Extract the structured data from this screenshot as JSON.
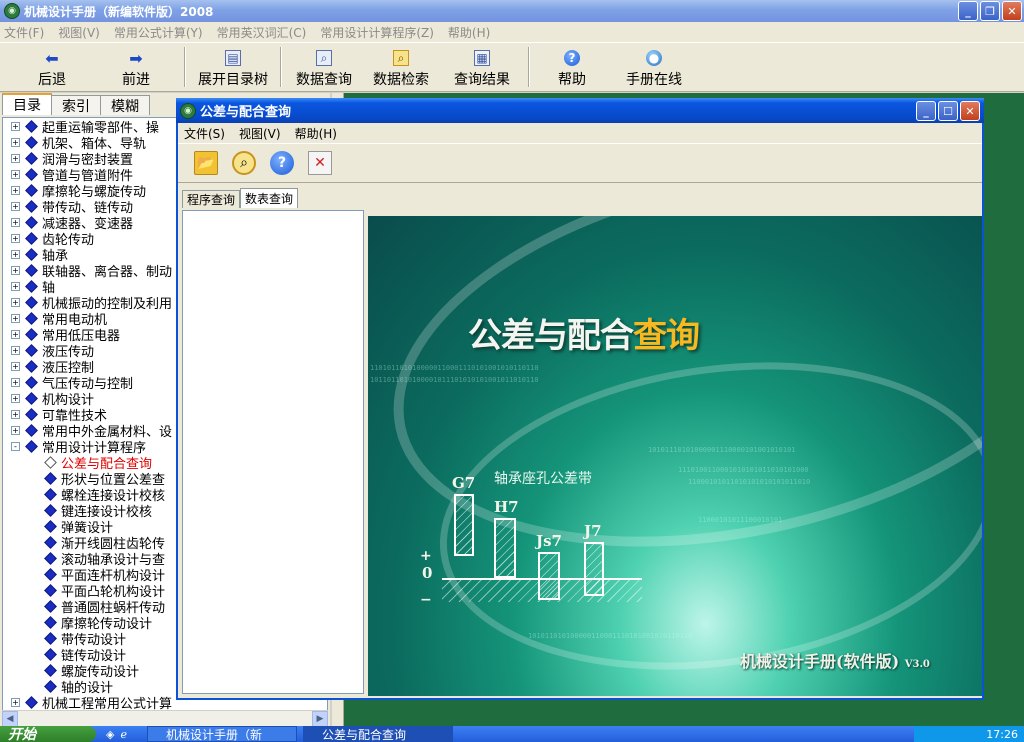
{
  "main_window": {
    "title": "机械设计手册（新编软件版）2008",
    "buttons": {
      "minimize": "_",
      "maximize": "❐",
      "close": "✕"
    }
  },
  "menu": [
    "文件(F)",
    "视图(V)",
    "常用公式计算(Y)",
    "常用英汉词汇(C)",
    "常用设计计算程序(Z)",
    "帮助(H)"
  ],
  "toolbar": [
    {
      "label": "后退",
      "icon": "arrow-left-icon"
    },
    {
      "label": "前进",
      "icon": "arrow-right-icon"
    },
    {
      "label": "展开目录树",
      "icon": "tree-doc-icon"
    },
    {
      "label": "数据查询",
      "icon": "data-query-icon"
    },
    {
      "label": "数据检索",
      "icon": "data-search-icon"
    },
    {
      "label": "查询结果",
      "icon": "results-icon"
    },
    {
      "label": "帮助",
      "icon": "help-icon"
    },
    {
      "label": "手册在线",
      "icon": "online-globe-icon"
    }
  ],
  "left_tabs": [
    "目录",
    "索引",
    "模糊"
  ],
  "tree": [
    {
      "label": "起重运输零部件、操",
      "level": 0,
      "expand": "+"
    },
    {
      "label": "机架、箱体、导轨",
      "level": 0,
      "expand": "+"
    },
    {
      "label": "润滑与密封装置",
      "level": 0,
      "expand": "+"
    },
    {
      "label": "管道与管道附件",
      "level": 0,
      "expand": "+"
    },
    {
      "label": "摩擦轮与螺旋传动",
      "level": 0,
      "expand": "+"
    },
    {
      "label": "带传动、链传动",
      "level": 0,
      "expand": "+"
    },
    {
      "label": "减速器、变速器",
      "level": 0,
      "expand": "+"
    },
    {
      "label": "齿轮传动",
      "level": 0,
      "expand": "+"
    },
    {
      "label": "轴承",
      "level": 0,
      "expand": "+"
    },
    {
      "label": "联轴器、离合器、制动",
      "level": 0,
      "expand": "+"
    },
    {
      "label": "轴",
      "level": 0,
      "expand": "+"
    },
    {
      "label": "机械振动的控制及利用",
      "level": 0,
      "expand": "+"
    },
    {
      "label": "常用电动机",
      "level": 0,
      "expand": "+"
    },
    {
      "label": "常用低压电器",
      "level": 0,
      "expand": "+"
    },
    {
      "label": "液压传动",
      "level": 0,
      "expand": "+"
    },
    {
      "label": "液压控制",
      "level": 0,
      "expand": "+"
    },
    {
      "label": "气压传动与控制",
      "level": 0,
      "expand": "+"
    },
    {
      "label": "机构设计",
      "level": 0,
      "expand": "+"
    },
    {
      "label": "可靠性技术",
      "level": 0,
      "expand": "+"
    },
    {
      "label": "常用中外金属材料、设",
      "level": 0,
      "expand": "+"
    },
    {
      "label": "常用设计计算程序",
      "level": 0,
      "expand": "-"
    },
    {
      "label": "公差与配合查询",
      "level": 1,
      "selected": true
    },
    {
      "label": "形状与位置公差查",
      "level": 1
    },
    {
      "label": "螺栓连接设计校核",
      "level": 1
    },
    {
      "label": "键连接设计校核",
      "level": 1
    },
    {
      "label": "弹簧设计",
      "level": 1
    },
    {
      "label": "渐开线圆柱齿轮传",
      "level": 1
    },
    {
      "label": "滚动轴承设计与查",
      "level": 1
    },
    {
      "label": "平面连杆机构设计",
      "level": 1
    },
    {
      "label": "平面凸轮机构设计",
      "level": 1
    },
    {
      "label": "普通圆柱蜗杆传动",
      "level": 1
    },
    {
      "label": "摩擦轮传动设计",
      "level": 1
    },
    {
      "label": "带传动设计",
      "level": 1
    },
    {
      "label": "链传动设计",
      "level": 1
    },
    {
      "label": "螺旋传动设计",
      "level": 1
    },
    {
      "label": "轴的设计",
      "level": 1
    },
    {
      "label": "机械工程常用公式计算",
      "level": 0,
      "expand": "+"
    }
  ],
  "child_window": {
    "title": "公差与配合查询",
    "menu": [
      "文件(S)",
      "视图(V)",
      "帮助(H)"
    ],
    "tools": [
      "open-folder-icon",
      "magnifier-icon",
      "help-icon",
      "delete-doc-icon"
    ],
    "tabs": [
      "程序查询",
      "数表查询"
    ],
    "splash": {
      "title_main": "公差与配合",
      "title_highlight": "查询",
      "axis_label": "轴承座孔公差带",
      "bars": [
        "G7",
        "H7",
        "Js7",
        "J7"
      ],
      "plus": "+",
      "zero": "0",
      "minus": "−",
      "brand": "机械设计手册(软件版)",
      "version": "V3.0",
      "binary_rows": [
        "1101011010100000110001110101001010110110",
        "1011011010100001011101010101001011010110",
        "10101110101000001110000101001010101",
        "11000101011010101010101011010",
        "1110100110001010101011010101000",
        "11000101011100010101",
        "101011010100000110001110101001010110110"
      ]
    }
  },
  "taskbar": {
    "start": "开始",
    "tasks": [
      "机械设计手册（新",
      "公差与配合查询"
    ],
    "clock": "17:26"
  }
}
